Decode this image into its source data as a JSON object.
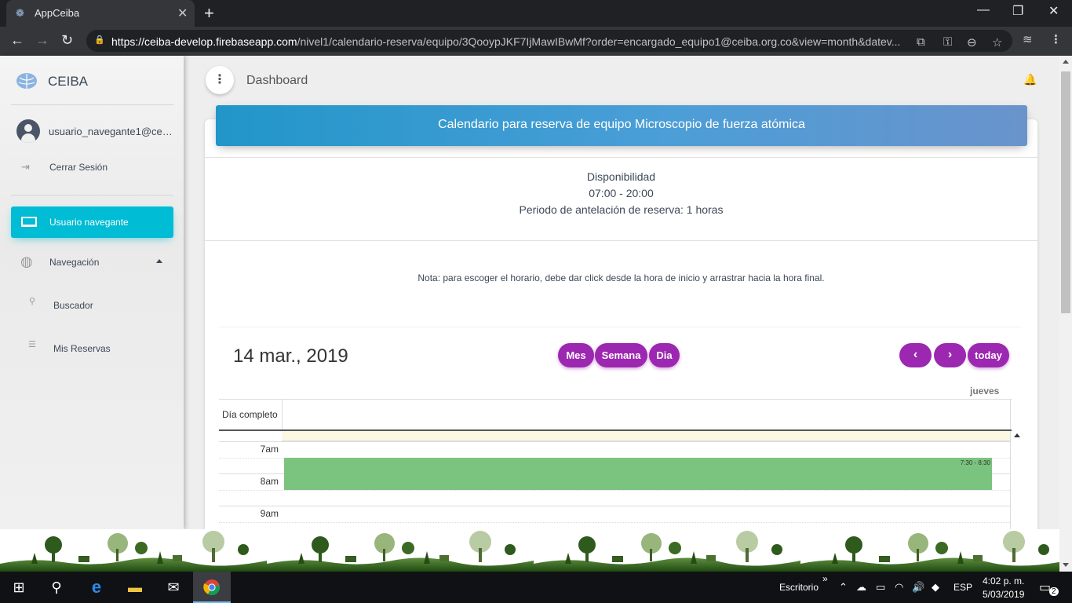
{
  "browser": {
    "tab_title": "AppCeiba",
    "url_host": "https://ceiba-develop.firebaseapp.com",
    "url_path": "/nivel1/calendario-reserva/equipo/3QooypJKF7IjMawIBwMf?order=encargado_equipo1@ceiba.org.co&view=month&datev..."
  },
  "sidebar": {
    "brand": "CEIBA",
    "user": "usuario_navegante1@ceiba.org.co",
    "logout": "Cerrar Sesión",
    "active_item": "Usuario navegante",
    "navigation": "Navegación",
    "search": "Buscador",
    "reservations": "Mis Reservas"
  },
  "header": {
    "title": "Dashboard"
  },
  "card": {
    "title": "Calendario para reserva de equipo Microscopio de fuerza atómica",
    "availability_label": "Disponibilidad",
    "availability_hours": "07:00 - 20:00",
    "advance_period": "Periodo de antelación de reserva: 1 horas",
    "note": "Nota: para escoger el horario, debe dar click desde la hora de inicio y arrastrar hacia la hora final."
  },
  "calendar": {
    "date": "14 mar., 2019",
    "views": [
      "Mes",
      "Semana",
      "Dia"
    ],
    "today": "today",
    "day_header": "jueves",
    "all_day": "Día completo",
    "hours": [
      "7am",
      "8am",
      "9am"
    ],
    "event_time": "7:30 - 8:30",
    "event_color": "#7bc47f"
  },
  "taskbar": {
    "desktop": "Escritorio",
    "lang": "ESP",
    "time": "4:02 p. m.",
    "date": "5/03/2019",
    "notifications": "2"
  },
  "colors": {
    "accent_cyan": "#00bcd4",
    "accent_purple": "#9c27b0",
    "header_blue": "#2196c9"
  }
}
